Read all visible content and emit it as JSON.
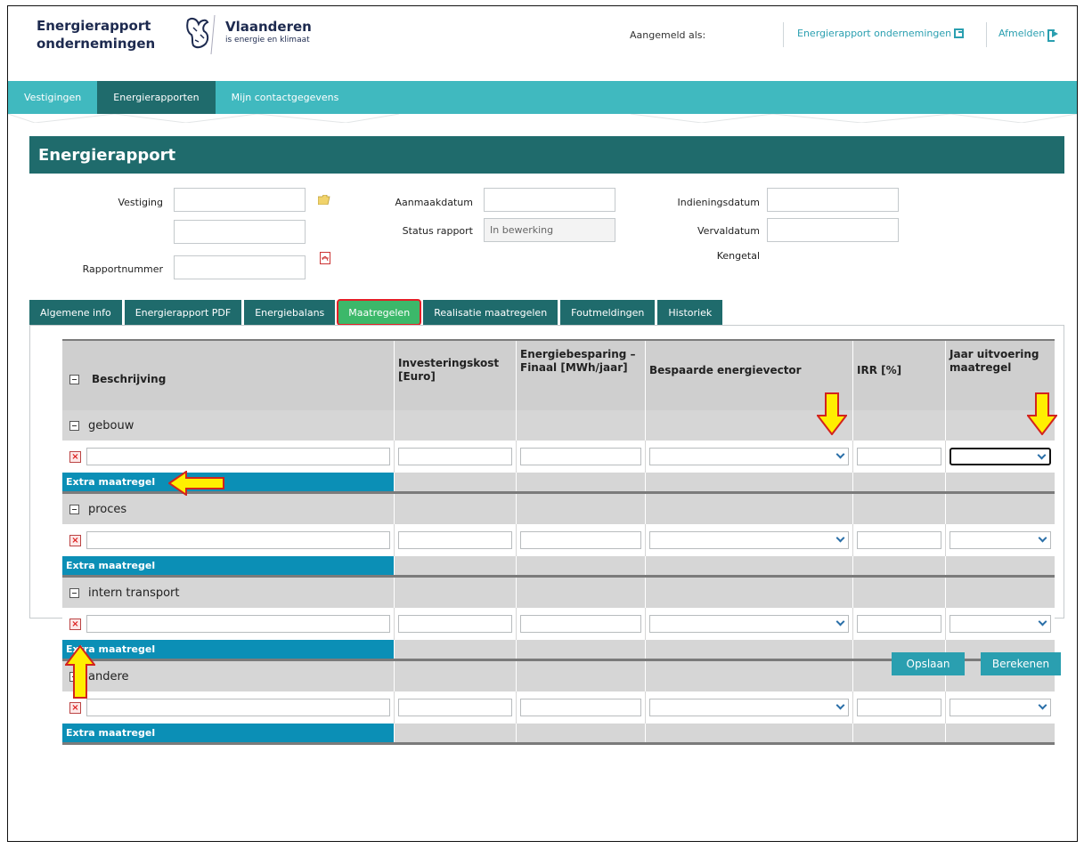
{
  "header": {
    "brand_line1": "Energierapport",
    "brand_line2": "ondernemingen",
    "logo_title": "Vlaanderen",
    "logo_subtitle": "is energie en klimaat",
    "logged_in_label": "Aangemeld als:",
    "app_link": "Energierapport ondernemingen",
    "logout_link": "Afmelden"
  },
  "topnav": [
    "Vestigingen",
    "Energierapporten",
    "Mijn contactgegevens"
  ],
  "page": {
    "title": "Energierapport",
    "labels": {
      "vestiging": "Vestiging",
      "rapportnummer": "Rapportnummer",
      "aanmaakdatum": "Aanmaakdatum",
      "status_rapport": "Status rapport",
      "indieningsdatum": "Indieningsdatum",
      "vervaldatum": "Vervaldatum",
      "kengetal": "Kengetal"
    },
    "status_value": "In bewerking"
  },
  "tabs": [
    "Algemene info",
    "Energierapport PDF",
    "Energiebalans",
    "Maatregelen",
    "Realisatie maatregelen",
    "Foutmeldingen",
    "Historiek"
  ],
  "grid": {
    "columns": [
      "Beschrijving",
      "Investeringskost [Euro]",
      "Energiebesparing – Finaal [MWh/jaar]",
      "Bespaarde energievector",
      "IRR [%]",
      "Jaar uitvoering maatregel"
    ],
    "categories": [
      "gebouw",
      "proces",
      "intern transport",
      "andere"
    ],
    "extra_label": "Extra maatregel"
  },
  "buttons": {
    "save": "Opslaan",
    "calculate": "Berekenen"
  },
  "colors": {
    "teal_dark": "#1f6b6c",
    "teal_nav": "#40b9bf",
    "active_tab": "#3cb86a",
    "extra_bar": "#0b8fb6",
    "highlight": "#e41e26",
    "arrow_fill": "#ffef00"
  }
}
